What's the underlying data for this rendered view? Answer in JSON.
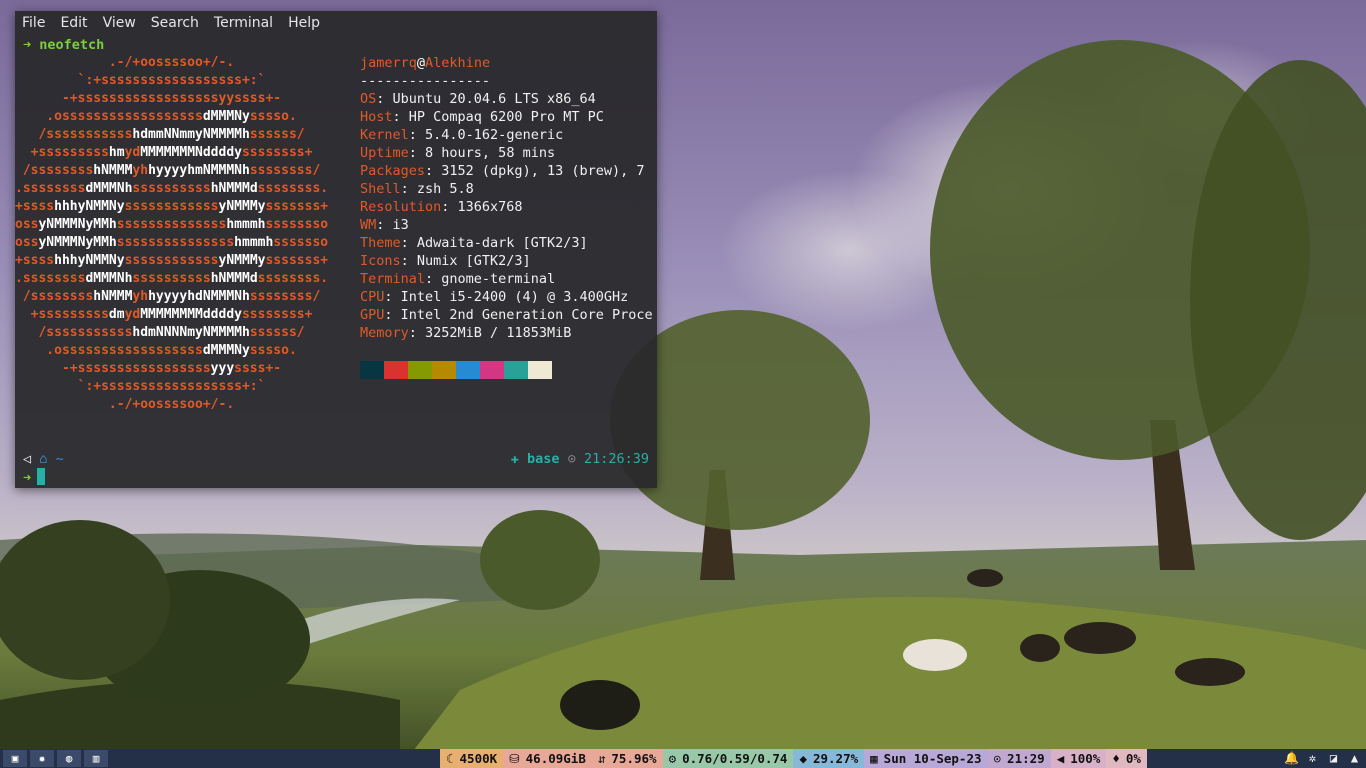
{
  "terminal": {
    "menu": [
      "File",
      "Edit",
      "View",
      "Search",
      "Terminal",
      "Help"
    ],
    "command": "neofetch",
    "prompt_arrow": "➜",
    "prompt": {
      "home_icon": "⌂",
      "left_marker": "◁",
      "dir": "~",
      "env_icon": "✚",
      "env": "base",
      "clock_icon": "⊙",
      "time": "21:26:39"
    },
    "neofetch": {
      "user": "jamerrq",
      "at": "@",
      "host": "Alekhine",
      "separator": "----------------",
      "fields": [
        {
          "key": "OS",
          "value": "Ubuntu 20.04.6 LTS x86_64"
        },
        {
          "key": "Host",
          "value": "HP Compaq 6200 Pro MT PC"
        },
        {
          "key": "Kernel",
          "value": "5.4.0-162-generic"
        },
        {
          "key": "Uptime",
          "value": "8 hours, 58 mins"
        },
        {
          "key": "Packages",
          "value": "3152 (dpkg), 13 (brew), 7"
        },
        {
          "key": "Shell",
          "value": "zsh 5.8"
        },
        {
          "key": "Resolution",
          "value": "1366x768"
        },
        {
          "key": "WM",
          "value": "i3"
        },
        {
          "key": "Theme",
          "value": "Adwaita-dark [GTK2/3]"
        },
        {
          "key": "Icons",
          "value": "Numix [GTK2/3]"
        },
        {
          "key": "Terminal",
          "value": "gnome-terminal"
        },
        {
          "key": "CPU",
          "value": "Intel i5-2400 (4) @ 3.400GHz"
        },
        {
          "key": "GPU",
          "value": "Intel 2nd Generation Core Proce"
        },
        {
          "key": "Memory",
          "value": "3252MiB / 11853MiB"
        }
      ],
      "palette": [
        "#073642",
        "#dc322f",
        "#859900",
        "#b58900",
        "#268bd2",
        "#d33682",
        "#2aa198",
        "#eee8d5"
      ],
      "logo": [
        [
          [
            "o",
            "            .-/+oossssoo+/-."
          ]
        ],
        [
          [
            "o",
            "        `:+ssssssssssssssssss+:`"
          ]
        ],
        [
          [
            "o",
            "      -+ssssssssssssssssssyyssss+-"
          ]
        ],
        [
          [
            "o",
            "    .ossssssssssssssssss"
          ],
          [
            "w",
            "dMMMNy"
          ],
          [
            "o",
            "sssso."
          ]
        ],
        [
          [
            "o",
            "   /sssssssssss"
          ],
          [
            "w",
            "hdmmNNmmyNMMMMh"
          ],
          [
            "o",
            "ssssss/"
          ]
        ],
        [
          [
            "o",
            "  +sssssssss"
          ],
          [
            "w",
            "hm"
          ],
          [
            "o",
            "yd"
          ],
          [
            "w",
            "MMMMMMMNddddy"
          ],
          [
            "o",
            "ssssssss+"
          ]
        ],
        [
          [
            "o",
            " /ssssssss"
          ],
          [
            "w",
            "hNMMM"
          ],
          [
            "o",
            "yh"
          ],
          [
            "w",
            "hyyyyhmNMMMNh"
          ],
          [
            "o",
            "ssssssss/"
          ]
        ],
        [
          [
            "o",
            ".ssssssss"
          ],
          [
            "w",
            "dMMMNh"
          ],
          [
            "o",
            "ssssssssss"
          ],
          [
            "w",
            "hNMMMd"
          ],
          [
            "o",
            "ssssssss."
          ]
        ],
        [
          [
            "o",
            "+ssss"
          ],
          [
            "w",
            "hhhyNMMNy"
          ],
          [
            "o",
            "ssssssssssss"
          ],
          [
            "w",
            "yNMMMy"
          ],
          [
            "o",
            "sssssss+"
          ]
        ],
        [
          [
            "o",
            "oss"
          ],
          [
            "w",
            "yNMMMNyMMh"
          ],
          [
            "o",
            "ssssssssssssss"
          ],
          [
            "w",
            "hmmmh"
          ],
          [
            "o",
            "ssssssso"
          ]
        ],
        [
          [
            "o",
            "oss"
          ],
          [
            "w",
            "yNMMMNyMMh"
          ],
          [
            "o",
            "sssssssssssssss"
          ],
          [
            "w",
            "hmmmh"
          ],
          [
            "o",
            "sssssso"
          ]
        ],
        [
          [
            "o",
            "+ssss"
          ],
          [
            "w",
            "hhhyNMMNy"
          ],
          [
            "o",
            "ssssssssssss"
          ],
          [
            "w",
            "yNMMMy"
          ],
          [
            "o",
            "sssssss+"
          ]
        ],
        [
          [
            "o",
            ".ssssssss"
          ],
          [
            "w",
            "dMMMNh"
          ],
          [
            "o",
            "ssssssssss"
          ],
          [
            "w",
            "hNMMMd"
          ],
          [
            "o",
            "ssssssss."
          ]
        ],
        [
          [
            "o",
            " /ssssssss"
          ],
          [
            "w",
            "hNMMM"
          ],
          [
            "o",
            "yh"
          ],
          [
            "w",
            "hyyyyhdNMMMNh"
          ],
          [
            "o",
            "ssssssss/"
          ]
        ],
        [
          [
            "o",
            "  +sssssssss"
          ],
          [
            "w",
            "dm"
          ],
          [
            "o",
            "yd"
          ],
          [
            "w",
            "MMMMMMMMddddy"
          ],
          [
            "o",
            "ssssssss+"
          ]
        ],
        [
          [
            "o",
            "   /sssssssssss"
          ],
          [
            "w",
            "hdmNNNNmyNMMMMh"
          ],
          [
            "o",
            "ssssss/"
          ]
        ],
        [
          [
            "o",
            "    .ossssssssssssssssss"
          ],
          [
            "w",
            "dMMMNy"
          ],
          [
            "o",
            "sssso."
          ]
        ],
        [
          [
            "o",
            "      -+sssssssssssssssss"
          ],
          [
            "w",
            "yyy"
          ],
          [
            "o",
            "ssss+-"
          ]
        ],
        [
          [
            "o",
            "        `:+ssssssssssssssssss+:`"
          ]
        ],
        [
          [
            "o",
            "            .-/+oossssoo+/-."
          ]
        ]
      ]
    }
  },
  "bar": {
    "workspaces": [
      {
        "icon": "robot-icon",
        "glyph": "▣"
      },
      {
        "icon": "bug-icon",
        "glyph": "✹"
      },
      {
        "icon": "globe-icon",
        "glyph": "◍"
      },
      {
        "icon": "piano-icon",
        "glyph": "▥"
      }
    ],
    "blocks": [
      {
        "name": "color-temp",
        "icon": "☾",
        "text": "4500K",
        "color": "#e8b070"
      },
      {
        "name": "disk",
        "icon": "⛁",
        "text": "46.09GiB",
        "color": "#e8a898"
      },
      {
        "name": "swap",
        "icon": "⇵",
        "text": "75.96%",
        "color": "#e8a898"
      },
      {
        "name": "load",
        "icon": "⚙",
        "text": "0.76/0.59/0.74",
        "color": "#98c8a8"
      },
      {
        "name": "memory",
        "icon": "◆",
        "text": "29.27%",
        "color": "#88b8d8"
      },
      {
        "name": "date",
        "icon": "▦",
        "text": "Sun 10-Sep-23",
        "color": "#b8a8d8"
      },
      {
        "name": "time",
        "icon": "⊙",
        "text": "21:29",
        "color": "#c0a8d0"
      },
      {
        "name": "volume",
        "icon": "◀",
        "text": "100%",
        "color": "#d8b0c8"
      },
      {
        "name": "mic",
        "icon": "♦",
        "text": "0%",
        "color": "#e0b8c0"
      }
    ],
    "tray": [
      {
        "icon": "bell-icon",
        "glyph": "🔔"
      },
      {
        "icon": "settings-icon",
        "glyph": "✲"
      },
      {
        "icon": "note-icon",
        "glyph": "◪"
      },
      {
        "icon": "vlc-icon",
        "glyph": "▲"
      }
    ]
  }
}
